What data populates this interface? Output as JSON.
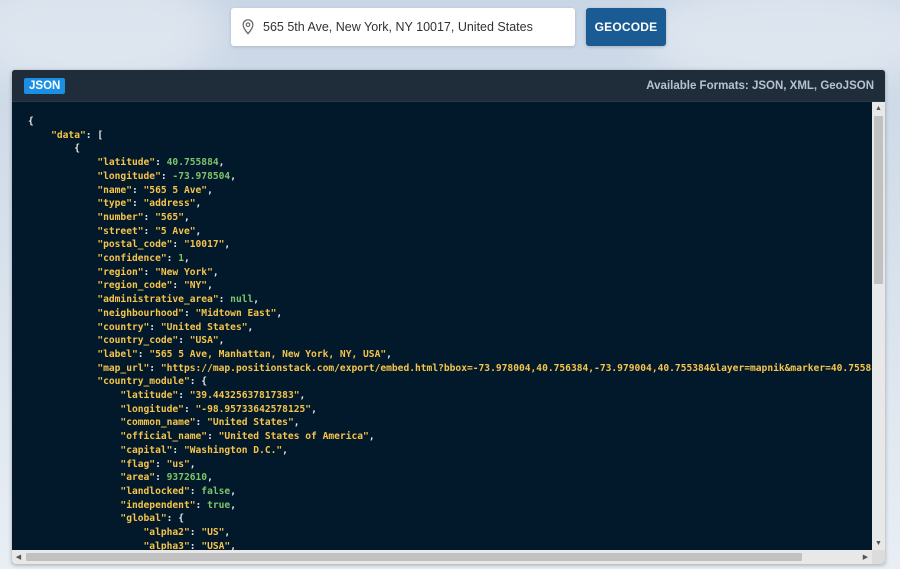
{
  "search": {
    "value": "565 5th Ave, New York, NY 10017, United States",
    "button_label": "GEOCODE"
  },
  "panel": {
    "badge": "JSON",
    "formats_text": "Available Formats: JSON, XML, GeoJSON"
  },
  "colors": {
    "panel_bg": "#02182b",
    "key": "#f5c44a",
    "number": "#7ec46a",
    "badge": "#1a8fe3",
    "button": "#1b5b94"
  },
  "code_lines": [
    [
      {
        "t": "p",
        "v": "{"
      }
    ],
    [
      {
        "t": "p",
        "v": "    "
      },
      {
        "t": "k",
        "v": "\"data\""
      },
      {
        "t": "p",
        "v": ": ["
      }
    ],
    [
      {
        "t": "p",
        "v": "        {"
      }
    ],
    [
      {
        "t": "p",
        "v": "            "
      },
      {
        "t": "k",
        "v": "\"latitude\""
      },
      {
        "t": "p",
        "v": ": "
      },
      {
        "t": "n",
        "v": "40.755884"
      },
      {
        "t": "p",
        "v": ","
      }
    ],
    [
      {
        "t": "p",
        "v": "            "
      },
      {
        "t": "k",
        "v": "\"longitude\""
      },
      {
        "t": "p",
        "v": ": "
      },
      {
        "t": "n",
        "v": "-73.978504"
      },
      {
        "t": "p",
        "v": ","
      }
    ],
    [
      {
        "t": "p",
        "v": "            "
      },
      {
        "t": "k",
        "v": "\"name\""
      },
      {
        "t": "p",
        "v": ": "
      },
      {
        "t": "s",
        "v": "\"565 5 Ave\""
      },
      {
        "t": "p",
        "v": ","
      }
    ],
    [
      {
        "t": "p",
        "v": "            "
      },
      {
        "t": "k",
        "v": "\"type\""
      },
      {
        "t": "p",
        "v": ": "
      },
      {
        "t": "s",
        "v": "\"address\""
      },
      {
        "t": "p",
        "v": ","
      }
    ],
    [
      {
        "t": "p",
        "v": "            "
      },
      {
        "t": "k",
        "v": "\"number\""
      },
      {
        "t": "p",
        "v": ": "
      },
      {
        "t": "s",
        "v": "\"565\""
      },
      {
        "t": "p",
        "v": ","
      }
    ],
    [
      {
        "t": "p",
        "v": "            "
      },
      {
        "t": "k",
        "v": "\"street\""
      },
      {
        "t": "p",
        "v": ": "
      },
      {
        "t": "s",
        "v": "\"5 Ave\""
      },
      {
        "t": "p",
        "v": ","
      }
    ],
    [
      {
        "t": "p",
        "v": "            "
      },
      {
        "t": "k",
        "v": "\"postal_code\""
      },
      {
        "t": "p",
        "v": ": "
      },
      {
        "t": "s",
        "v": "\"10017\""
      },
      {
        "t": "p",
        "v": ","
      }
    ],
    [
      {
        "t": "p",
        "v": "            "
      },
      {
        "t": "k",
        "v": "\"confidence\""
      },
      {
        "t": "p",
        "v": ": "
      },
      {
        "t": "n",
        "v": "1"
      },
      {
        "t": "p",
        "v": ","
      }
    ],
    [
      {
        "t": "p",
        "v": "            "
      },
      {
        "t": "k",
        "v": "\"region\""
      },
      {
        "t": "p",
        "v": ": "
      },
      {
        "t": "s",
        "v": "\"New York\""
      },
      {
        "t": "p",
        "v": ","
      }
    ],
    [
      {
        "t": "p",
        "v": "            "
      },
      {
        "t": "k",
        "v": "\"region_code\""
      },
      {
        "t": "p",
        "v": ": "
      },
      {
        "t": "s",
        "v": "\"NY\""
      },
      {
        "t": "p",
        "v": ","
      }
    ],
    [
      {
        "t": "p",
        "v": "            "
      },
      {
        "t": "k",
        "v": "\"administrative_area\""
      },
      {
        "t": "p",
        "v": ": "
      },
      {
        "t": "n",
        "v": "null"
      },
      {
        "t": "p",
        "v": ","
      }
    ],
    [
      {
        "t": "p",
        "v": "            "
      },
      {
        "t": "k",
        "v": "\"neighbourhood\""
      },
      {
        "t": "p",
        "v": ": "
      },
      {
        "t": "s",
        "v": "\"Midtown East\""
      },
      {
        "t": "p",
        "v": ","
      }
    ],
    [
      {
        "t": "p",
        "v": "            "
      },
      {
        "t": "k",
        "v": "\"country\""
      },
      {
        "t": "p",
        "v": ": "
      },
      {
        "t": "s",
        "v": "\"United States\""
      },
      {
        "t": "p",
        "v": ","
      }
    ],
    [
      {
        "t": "p",
        "v": "            "
      },
      {
        "t": "k",
        "v": "\"country_code\""
      },
      {
        "t": "p",
        "v": ": "
      },
      {
        "t": "s",
        "v": "\"USA\""
      },
      {
        "t": "p",
        "v": ","
      }
    ],
    [
      {
        "t": "p",
        "v": "            "
      },
      {
        "t": "k",
        "v": "\"label\""
      },
      {
        "t": "p",
        "v": ": "
      },
      {
        "t": "s",
        "v": "\"565 5 Ave, Manhattan, New York, NY, USA\""
      },
      {
        "t": "p",
        "v": ","
      }
    ],
    [
      {
        "t": "p",
        "v": "            "
      },
      {
        "t": "k",
        "v": "\"map_url\""
      },
      {
        "t": "p",
        "v": ": "
      },
      {
        "t": "s",
        "v": "\"https://map.positionstack.com/export/embed.html?bbox=-73.978004,40.756384,-73.979004,40.755384&layer=mapnik&marker=40.755884,-73."
      }
    ],
    [
      {
        "t": "p",
        "v": "            "
      },
      {
        "t": "k",
        "v": "\"country_module\""
      },
      {
        "t": "p",
        "v": ": {"
      }
    ],
    [
      {
        "t": "p",
        "v": "                "
      },
      {
        "t": "k",
        "v": "\"latitude\""
      },
      {
        "t": "p",
        "v": ": "
      },
      {
        "t": "s",
        "v": "\"39.44325637817383\""
      },
      {
        "t": "p",
        "v": ","
      }
    ],
    [
      {
        "t": "p",
        "v": "                "
      },
      {
        "t": "k",
        "v": "\"longitude\""
      },
      {
        "t": "p",
        "v": ": "
      },
      {
        "t": "s",
        "v": "\"-98.95733642578125\""
      },
      {
        "t": "p",
        "v": ","
      }
    ],
    [
      {
        "t": "p",
        "v": "                "
      },
      {
        "t": "k",
        "v": "\"common_name\""
      },
      {
        "t": "p",
        "v": ": "
      },
      {
        "t": "s",
        "v": "\"United States\""
      },
      {
        "t": "p",
        "v": ","
      }
    ],
    [
      {
        "t": "p",
        "v": "                "
      },
      {
        "t": "k",
        "v": "\"official_name\""
      },
      {
        "t": "p",
        "v": ": "
      },
      {
        "t": "s",
        "v": "\"United States of America\""
      },
      {
        "t": "p",
        "v": ","
      }
    ],
    [
      {
        "t": "p",
        "v": "                "
      },
      {
        "t": "k",
        "v": "\"capital\""
      },
      {
        "t": "p",
        "v": ": "
      },
      {
        "t": "s",
        "v": "\"Washington D.C.\""
      },
      {
        "t": "p",
        "v": ","
      }
    ],
    [
      {
        "t": "p",
        "v": "                "
      },
      {
        "t": "k",
        "v": "\"flag\""
      },
      {
        "t": "p",
        "v": ": "
      },
      {
        "t": "s",
        "v": "\"us\""
      },
      {
        "t": "p",
        "v": ","
      }
    ],
    [
      {
        "t": "p",
        "v": "                "
      },
      {
        "t": "k",
        "v": "\"area\""
      },
      {
        "t": "p",
        "v": ": "
      },
      {
        "t": "n",
        "v": "9372610"
      },
      {
        "t": "p",
        "v": ","
      }
    ],
    [
      {
        "t": "p",
        "v": "                "
      },
      {
        "t": "k",
        "v": "\"landlocked\""
      },
      {
        "t": "p",
        "v": ": "
      },
      {
        "t": "n",
        "v": "false"
      },
      {
        "t": "p",
        "v": ","
      }
    ],
    [
      {
        "t": "p",
        "v": "                "
      },
      {
        "t": "k",
        "v": "\"independent\""
      },
      {
        "t": "p",
        "v": ": "
      },
      {
        "t": "n",
        "v": "true"
      },
      {
        "t": "p",
        "v": ","
      }
    ],
    [
      {
        "t": "p",
        "v": "                "
      },
      {
        "t": "k",
        "v": "\"global\""
      },
      {
        "t": "p",
        "v": ": {"
      }
    ],
    [
      {
        "t": "p",
        "v": "                    "
      },
      {
        "t": "k",
        "v": "\"alpha2\""
      },
      {
        "t": "p",
        "v": ": "
      },
      {
        "t": "s",
        "v": "\"US\""
      },
      {
        "t": "p",
        "v": ","
      }
    ],
    [
      {
        "t": "p",
        "v": "                    "
      },
      {
        "t": "k",
        "v": "\"alpha3\""
      },
      {
        "t": "p",
        "v": ": "
      },
      {
        "t": "s",
        "v": "\"USA\""
      },
      {
        "t": "p",
        "v": ","
      }
    ]
  ]
}
